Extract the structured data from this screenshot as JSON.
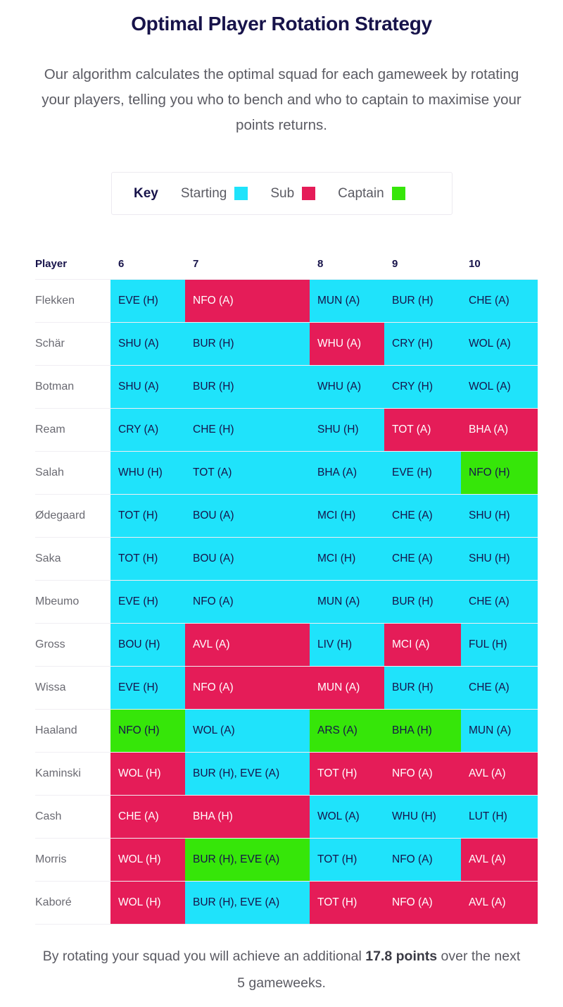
{
  "header": {
    "title": "Optimal Player Rotation Strategy",
    "intro": "Our algorithm calculates the optimal squad for each gameweek by rotating your players, telling you who to bench and who to captain to maximise your points returns."
  },
  "key": {
    "label": "Key",
    "entries": [
      {
        "name": "Starting",
        "color": "#1fe3fb",
        "status": "start"
      },
      {
        "name": "Sub",
        "color": "#e51c58",
        "status": "sub"
      },
      {
        "name": "Captain",
        "color": "#36e609",
        "status": "cap"
      }
    ]
  },
  "table": {
    "player_header": "Player",
    "gameweeks": [
      "6",
      "7",
      "8",
      "9",
      "10"
    ],
    "rows": [
      {
        "player": "Flekken",
        "cells": [
          {
            "text": "EVE (H)",
            "status": "start",
            "col": 0,
            "span": 1
          },
          {
            "text": "NFO (A)",
            "status": "sub",
            "col": 1,
            "span": 1
          },
          {
            "text": "MUN (A)",
            "status": "start",
            "col": 2,
            "span": 1
          },
          {
            "text": "BUR (H)",
            "status": "start",
            "col": 3,
            "span": 1
          },
          {
            "text": "CHE (A)",
            "status": "start",
            "col": 4,
            "span": 1
          }
        ]
      },
      {
        "player": "Schär",
        "cells": [
          {
            "text": "SHU (A)",
            "status": "start",
            "col": 0,
            "span": 1
          },
          {
            "text": "BUR (H)",
            "status": "start",
            "col": 1,
            "span": 1
          },
          {
            "text": "WHU (A)",
            "status": "sub",
            "col": 2,
            "span": 1
          },
          {
            "text": "CRY (H)",
            "status": "start",
            "col": 3,
            "span": 1
          },
          {
            "text": "WOL (A)",
            "status": "start",
            "col": 4,
            "span": 1
          }
        ]
      },
      {
        "player": "Botman",
        "cells": [
          {
            "text": "SHU (A)",
            "status": "start",
            "col": 0,
            "span": 1
          },
          {
            "text": "BUR (H)",
            "status": "start",
            "col": 1,
            "span": 1
          },
          {
            "text": "WHU (A)",
            "status": "start",
            "col": 2,
            "span": 1
          },
          {
            "text": "CRY (H)",
            "status": "start",
            "col": 3,
            "span": 1
          },
          {
            "text": "WOL (A)",
            "status": "start",
            "col": 4,
            "span": 1
          }
        ]
      },
      {
        "player": "Ream",
        "cells": [
          {
            "text": "CRY (A)",
            "status": "start",
            "col": 0,
            "span": 1
          },
          {
            "text": "CHE (H)",
            "status": "start",
            "col": 1,
            "span": 1
          },
          {
            "text": "SHU (H)",
            "status": "start",
            "col": 2,
            "span": 1
          },
          {
            "text": "TOT (A)",
            "status": "sub",
            "col": 3,
            "span": 1
          },
          {
            "text": "BHA (A)",
            "status": "sub",
            "col": 4,
            "span": 1
          }
        ]
      },
      {
        "player": "Salah",
        "cells": [
          {
            "text": "WHU (H)",
            "status": "start",
            "col": 0,
            "span": 1
          },
          {
            "text": "TOT (A)",
            "status": "start",
            "col": 1,
            "span": 1
          },
          {
            "text": "BHA (A)",
            "status": "start",
            "col": 2,
            "span": 1
          },
          {
            "text": "EVE (H)",
            "status": "start",
            "col": 3,
            "span": 1
          },
          {
            "text": "NFO (H)",
            "status": "cap",
            "col": 4,
            "span": 1
          }
        ]
      },
      {
        "player": "Ødegaard",
        "cells": [
          {
            "text": "TOT (H)",
            "status": "start",
            "col": 0,
            "span": 1
          },
          {
            "text": "BOU (A)",
            "status": "start",
            "col": 1,
            "span": 1
          },
          {
            "text": "MCI (H)",
            "status": "start",
            "col": 2,
            "span": 1
          },
          {
            "text": "CHE (A)",
            "status": "start",
            "col": 3,
            "span": 1
          },
          {
            "text": "SHU (H)",
            "status": "start",
            "col": 4,
            "span": 1
          }
        ]
      },
      {
        "player": "Saka",
        "cells": [
          {
            "text": "TOT (H)",
            "status": "start",
            "col": 0,
            "span": 1
          },
          {
            "text": "BOU (A)",
            "status": "start",
            "col": 1,
            "span": 1
          },
          {
            "text": "MCI (H)",
            "status": "start",
            "col": 2,
            "span": 1
          },
          {
            "text": "CHE (A)",
            "status": "start",
            "col": 3,
            "span": 1
          },
          {
            "text": "SHU (H)",
            "status": "start",
            "col": 4,
            "span": 1
          }
        ]
      },
      {
        "player": "Mbeumo",
        "cells": [
          {
            "text": "EVE (H)",
            "status": "start",
            "col": 0,
            "span": 1
          },
          {
            "text": "NFO (A)",
            "status": "start",
            "col": 1,
            "span": 1
          },
          {
            "text": "MUN (A)",
            "status": "start",
            "col": 2,
            "span": 1
          },
          {
            "text": "BUR (H)",
            "status": "start",
            "col": 3,
            "span": 1
          },
          {
            "text": "CHE (A)",
            "status": "start",
            "col": 4,
            "span": 1
          }
        ]
      },
      {
        "player": "Gross",
        "cells": [
          {
            "text": "BOU (H)",
            "status": "start",
            "col": 0,
            "span": 1
          },
          {
            "text": "AVL (A)",
            "status": "sub",
            "col": 1,
            "span": 1
          },
          {
            "text": "LIV (H)",
            "status": "start",
            "col": 2,
            "span": 1
          },
          {
            "text": "MCI (A)",
            "status": "sub",
            "col": 3,
            "span": 1
          },
          {
            "text": "FUL (H)",
            "status": "start",
            "col": 4,
            "span": 1
          }
        ]
      },
      {
        "player": "Wissa",
        "cells": [
          {
            "text": "EVE (H)",
            "status": "start",
            "col": 0,
            "span": 1
          },
          {
            "text": "NFO (A)",
            "status": "sub",
            "col": 1,
            "span": 1
          },
          {
            "text": "MUN (A)",
            "status": "sub",
            "col": 2,
            "span": 1
          },
          {
            "text": "BUR (H)",
            "status": "start",
            "col": 3,
            "span": 1
          },
          {
            "text": "CHE (A)",
            "status": "start",
            "col": 4,
            "span": 1
          }
        ]
      },
      {
        "player": "Haaland",
        "cells": [
          {
            "text": "NFO (H)",
            "status": "cap",
            "col": 0,
            "span": 1
          },
          {
            "text": "WOL (A)",
            "status": "start",
            "col": 1,
            "span": 1
          },
          {
            "text": "ARS (A)",
            "status": "cap",
            "col": 2,
            "span": 1
          },
          {
            "text": "BHA (H)",
            "status": "cap",
            "col": 3,
            "span": 1
          },
          {
            "text": "MUN (A)",
            "status": "start",
            "col": 4,
            "span": 1
          }
        ]
      },
      {
        "player": "Kaminski",
        "cells": [
          {
            "text": "WOL (H)",
            "status": "sub",
            "col": 0,
            "span": 1
          },
          {
            "text": "BUR (H), EVE (A)",
            "status": "start",
            "col": 1,
            "span": 1
          },
          {
            "text": "TOT (H)",
            "status": "sub",
            "col": 2,
            "span": 1
          },
          {
            "text": "NFO (A)",
            "status": "sub",
            "col": 3,
            "span": 1
          },
          {
            "text": "AVL (A)",
            "status": "sub",
            "col": 4,
            "span": 1
          }
        ]
      },
      {
        "player": "Cash",
        "cells": [
          {
            "text": "CHE (A)",
            "status": "sub",
            "col": 0,
            "span": 1
          },
          {
            "text": "BHA (H)",
            "status": "sub",
            "col": 1,
            "span": 1
          },
          {
            "text": "WOL (A)",
            "status": "start",
            "col": 2,
            "span": 1
          },
          {
            "text": "WHU (H)",
            "status": "start",
            "col": 3,
            "span": 1
          },
          {
            "text": "LUT (H)",
            "status": "start",
            "col": 4,
            "span": 1
          }
        ]
      },
      {
        "player": "Morris",
        "cells": [
          {
            "text": "WOL (H)",
            "status": "sub",
            "col": 0,
            "span": 1
          },
          {
            "text": "BUR (H), EVE (A)",
            "status": "cap",
            "col": 1,
            "span": 1
          },
          {
            "text": "TOT (H)",
            "status": "start",
            "col": 2,
            "span": 1
          },
          {
            "text": "NFO (A)",
            "status": "start",
            "col": 3,
            "span": 1
          },
          {
            "text": "AVL (A)",
            "status": "sub",
            "col": 4,
            "span": 1
          }
        ]
      },
      {
        "player": "Kaboré",
        "cells": [
          {
            "text": "WOL (H)",
            "status": "sub",
            "col": 0,
            "span": 1
          },
          {
            "text": "BUR (H), EVE (A)",
            "status": "start",
            "col": 1,
            "span": 1
          },
          {
            "text": "TOT (H)",
            "status": "sub",
            "col": 2,
            "span": 1
          },
          {
            "text": "NFO (A)",
            "status": "sub",
            "col": 3,
            "span": 1
          },
          {
            "text": "AVL (A)",
            "status": "sub",
            "col": 4,
            "span": 1
          }
        ]
      }
    ]
  },
  "footer": {
    "part1": "By rotating your squad you will achieve an additional ",
    "bold1": "17.8 points",
    "part2": " over the next 5 gameweeks."
  }
}
